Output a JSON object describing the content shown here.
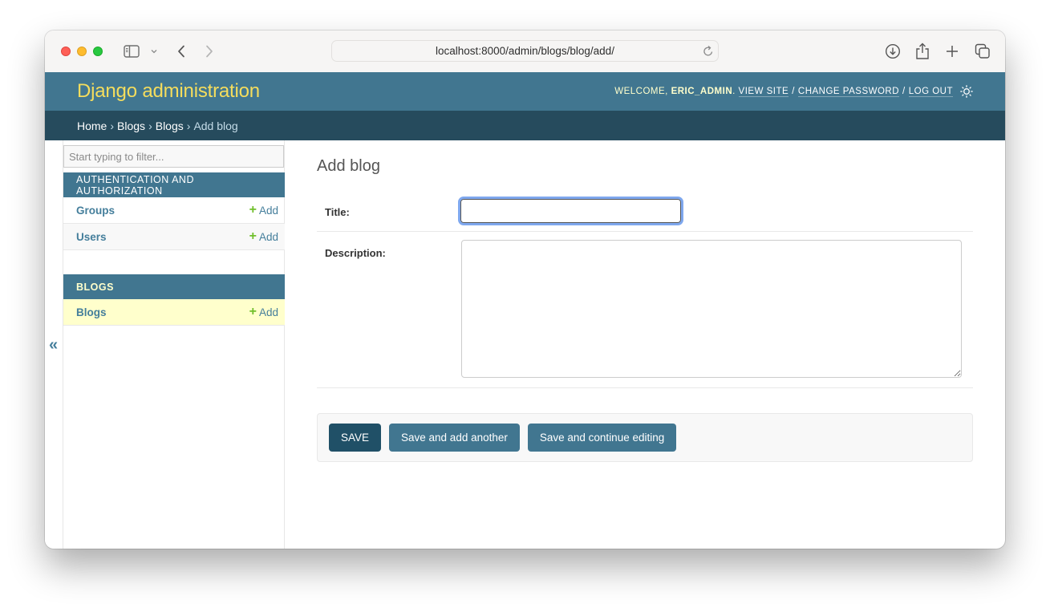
{
  "browser": {
    "url": "localhost:8000/admin/blogs/blog/add/",
    "icons": {
      "sidebar": "sidebar-icon",
      "dropdown": "chevron-down-icon",
      "back": "chevron-left-icon",
      "forward": "chevron-right-icon",
      "reload": "reload-icon",
      "download": "download-icon",
      "share": "share-icon",
      "new_tab": "plus-icon",
      "tabs": "tab-overview-icon"
    }
  },
  "header": {
    "branding": "Django administration",
    "welcome": "Welcome,",
    "username": "eric_admin",
    "period": ".",
    "view_site": "View site",
    "change_password": "Change password",
    "log_out": "Log out",
    "separator": "/",
    "theme_icon": "sun-icon"
  },
  "breadcrumbs": {
    "items": [
      "Home",
      "Blogs",
      "Blogs"
    ],
    "current": "Add blog",
    "separator": "›"
  },
  "sidebar": {
    "toggle_glyph": "«",
    "filter_placeholder": "Start typing to filter...",
    "filter_value": "",
    "modules": [
      {
        "caption": "Authentication and Authorization",
        "caption_display": "AUTHENTICATION AND AUTHORIZATION",
        "models": [
          {
            "name": "Groups",
            "add_label": "Add"
          },
          {
            "name": "Users",
            "add_label": "Add"
          }
        ]
      },
      {
        "caption": "Blogs",
        "caption_display": "BLOGS",
        "models": [
          {
            "name": "Blogs",
            "add_label": "Add",
            "current": true
          }
        ]
      }
    ],
    "add_glyph": "+"
  },
  "content": {
    "title": "Add blog",
    "fields": [
      {
        "label": "Title:",
        "value": ""
      },
      {
        "label": "Description:",
        "value": ""
      }
    ],
    "buttons": {
      "save": "SAVE",
      "save_add_another": "Save and add another",
      "save_continue": "Save and continue editing"
    }
  },
  "colors": {
    "header_bg": "#417690",
    "breadcrumbs_bg": "#264b5d",
    "branding": "#f5dd5d",
    "link": "#447e9b",
    "add_icon": "#70bf2b",
    "current_row": "#ffffcc",
    "save_button": "#205067"
  }
}
